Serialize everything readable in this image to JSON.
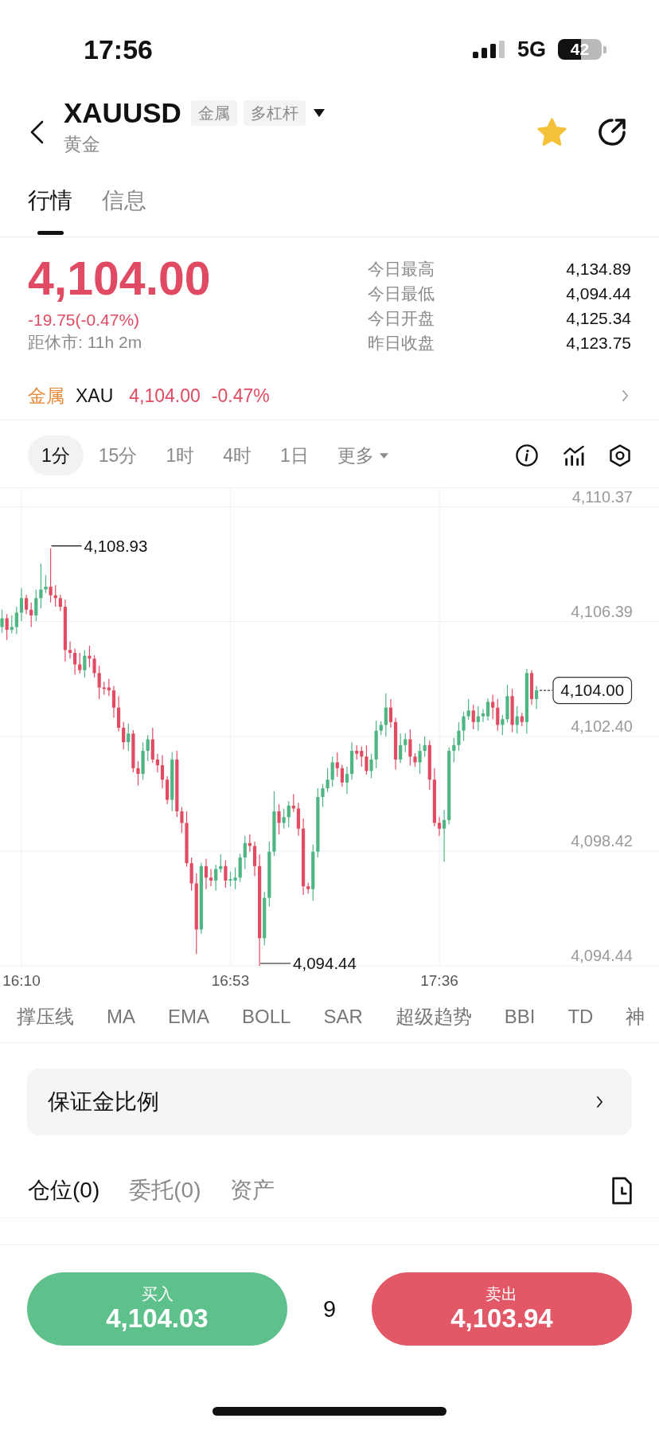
{
  "status_bar": {
    "time": "17:56",
    "network": "5G",
    "battery": "42"
  },
  "header": {
    "symbol": "XAUUSD",
    "tags": [
      "金属",
      "多杠杆"
    ],
    "subtitle": "黄金",
    "favorite": true
  },
  "tabs": [
    {
      "label": "行情",
      "selected": true
    },
    {
      "label": "信息",
      "selected": false
    }
  ],
  "quote": {
    "price": "4,104.00",
    "change": "-19.75(-0.47%)",
    "negative": true,
    "countdown": "距休市: 11h 2m",
    "stats": [
      {
        "label": "今日最高",
        "value": "4,134.89"
      },
      {
        "label": "今日最低",
        "value": "4,094.44"
      },
      {
        "label": "今日开盘",
        "value": "4,125.34"
      },
      {
        "label": "昨日收盘",
        "value": "4,123.75"
      }
    ]
  },
  "related": {
    "category": "金属",
    "symbol": "XAU",
    "price": "4,104.00",
    "change": "-0.47%",
    "negative": true
  },
  "intervals": [
    {
      "label": "1分",
      "kind": "option",
      "selected": true
    },
    {
      "label": "15分",
      "kind": "option",
      "selected": false
    },
    {
      "label": "1时",
      "kind": "option",
      "selected": false
    },
    {
      "label": "4时",
      "kind": "option",
      "selected": false
    },
    {
      "label": "1日",
      "kind": "option",
      "selected": false
    },
    {
      "label": "更多",
      "kind": "menu",
      "selected": false
    }
  ],
  "chart": {
    "chart_data": {
      "type": "candlestick",
      "categories": [
        null,
        null,
        null,
        null,
        "16:10",
        null,
        null,
        null,
        null,
        null,
        null,
        null,
        null,
        null,
        null,
        null,
        null,
        null,
        null,
        null,
        null,
        null,
        null,
        null,
        null,
        null,
        null,
        null,
        null,
        null,
        null,
        null,
        null,
        null,
        null,
        null,
        null,
        null,
        null,
        null,
        null,
        null,
        null,
        null,
        null,
        null,
        null,
        "16:53",
        null,
        null,
        null,
        null,
        null,
        null,
        null,
        null,
        null,
        null,
        null,
        null,
        null,
        null,
        null,
        null,
        null,
        null,
        null,
        null,
        null,
        null,
        null,
        null,
        null,
        null,
        null,
        null,
        null,
        null,
        null,
        null,
        null,
        null,
        null,
        null,
        null,
        null,
        null,
        null,
        null,
        null,
        "17:36",
        null,
        null,
        null,
        null,
        null,
        null,
        null,
        null,
        null,
        null,
        null,
        null,
        null,
        null,
        null,
        null,
        null,
        null,
        null,
        null
      ],
      "ohlc": [
        [
          4106.2,
          4106.8,
          4106.0,
          4106.5
        ],
        [
          4106.5,
          4106.65,
          4105.75,
          4106.1
        ],
        [
          4106.1,
          4106.6,
          4105.98,
          4106.2
        ],
        [
          4106.2,
          4106.9,
          4105.95,
          4106.7
        ],
        [
          4106.7,
          4107.55,
          4106.4,
          4107.2
        ],
        [
          4107.2,
          4107.32,
          4106.65,
          4106.8
        ],
        [
          4106.8,
          4107.05,
          4106.2,
          4106.6
        ],
        [
          4106.6,
          4107.5,
          4106.4,
          4107.2
        ],
        [
          4107.2,
          4108.4,
          4106.85,
          4107.5
        ],
        [
          4107.5,
          4108.0,
          4107.38,
          4107.6
        ],
        [
          4107.6,
          4108.93,
          4107.05,
          4107.3
        ],
        [
          4107.3,
          4107.65,
          4106.9,
          4107.2
        ],
        [
          4107.2,
          4107.32,
          4106.75,
          4106.9
        ],
        [
          4106.9,
          4107.15,
          4105.0,
          4105.4
        ],
        [
          4105.4,
          4105.7,
          4105.1,
          4105.3
        ],
        [
          4105.3,
          4105.45,
          4104.55,
          4104.9
        ],
        [
          4104.9,
          4105.3,
          4104.58,
          4104.7
        ],
        [
          4104.7,
          4105.4,
          4104.45,
          4105.2
        ],
        [
          4105.2,
          4105.55,
          4104.8,
          4105.1
        ],
        [
          4105.1,
          4105.22,
          4104.45,
          4104.6
        ],
        [
          4104.6,
          4104.85,
          4103.7,
          4104.1
        ],
        [
          4104.1,
          4104.3,
          4103.85,
          4104.05
        ],
        [
          4104.1,
          4104.4,
          4103.8,
          4104.0
        ],
        [
          4104.0,
          4104.15,
          4103.05,
          4103.4
        ],
        [
          4103.4,
          4103.8,
          4102.58,
          4102.7
        ],
        [
          4102.7,
          4102.9,
          4101.95,
          4102.2
        ],
        [
          4102.2,
          4102.85,
          4101.9,
          4102.5
        ],
        [
          4102.5,
          4102.62,
          4101.15,
          4101.3
        ],
        [
          4101.3,
          4101.55,
          4100.7,
          4101.1
        ],
        [
          4101.1,
          4102.2,
          4100.9,
          4101.9
        ],
        [
          4101.9,
          4102.45,
          4101.55,
          4102.3
        ],
        [
          4102.3,
          4102.7,
          4101.48,
          4101.6
        ],
        [
          4101.6,
          4101.8,
          4101.15,
          4101.4
        ],
        [
          4101.4,
          4101.75,
          4100.6,
          4100.9
        ],
        [
          4100.9,
          4101.02,
          4100.05,
          4100.2
        ],
        [
          4100.2,
          4101.85,
          4099.8,
          4101.6
        ],
        [
          4101.6,
          4101.9,
          4099.6,
          4099.8
        ],
        [
          4099.8,
          4099.95,
          4099.05,
          4099.4
        ],
        [
          4099.4,
          4099.8,
          4097.88,
          4098.0
        ],
        [
          4098.0,
          4098.2,
          4097.05,
          4097.3
        ],
        [
          4097.3,
          4097.65,
          4094.85,
          4095.7
        ],
        [
          4095.7,
          4098.02,
          4095.55,
          4097.9
        ],
        [
          4097.9,
          4098.15,
          4097.1,
          4097.5
        ],
        [
          4097.5,
          4097.8,
          4097.2,
          4097.4
        ],
        [
          4097.4,
          4097.95,
          4097.05,
          4097.8
        ],
        [
          4097.8,
          4098.3,
          4097.68,
          4097.9
        ],
        [
          4097.9,
          4098.1,
          4097.15,
          4097.4
        ],
        [
          4097.4,
          4097.7,
          4097.2,
          4097.45
        ],
        [
          4097.4,
          4097.85,
          4097.1,
          4097.5
        ],
        [
          4097.5,
          4098.32,
          4097.35,
          4098.2
        ],
        [
          4098.2,
          4098.95,
          4097.8,
          4098.7
        ],
        [
          4098.7,
          4099.0,
          4098.4,
          4098.6
        ],
        [
          4098.6,
          4098.75,
          4097.55,
          4097.9
        ],
        [
          4097.9,
          4098.3,
          4094.44,
          4095.4
        ],
        [
          4095.4,
          4097.0,
          4095.15,
          4096.8
        ],
        [
          4096.8,
          4098.75,
          4096.5,
          4098.4
        ],
        [
          4098.4,
          4100.5,
          4098.25,
          4099.8
        ],
        [
          4099.8,
          4100.05,
          4099.0,
          4099.4
        ],
        [
          4099.4,
          4099.9,
          4099.2,
          4099.6
        ],
        [
          4099.6,
          4100.15,
          4099.25,
          4100.0
        ],
        [
          4100.0,
          4100.4,
          4099.78,
          4099.9
        ],
        [
          4099.9,
          4100.1,
          4098.95,
          4099.2
        ],
        [
          4099.2,
          4099.55,
          4096.9,
          4097.2
        ],
        [
          4097.2,
          4097.32,
          4096.95,
          4097.1
        ],
        [
          4097.1,
          4098.65,
          4096.7,
          4098.4
        ],
        [
          4098.4,
          4100.6,
          4098.2,
          4100.3
        ],
        [
          4100.3,
          4100.75,
          4099.95,
          4100.6
        ],
        [
          4100.6,
          4101.3,
          4100.48,
          4100.9
        ],
        [
          4100.9,
          4101.7,
          4100.65,
          4101.5
        ],
        [
          4101.5,
          4101.85,
          4101.0,
          4101.3
        ],
        [
          4101.3,
          4101.42,
          4100.65,
          4100.8
        ],
        [
          4100.8,
          4101.35,
          4100.4,
          4101.1
        ],
        [
          4101.1,
          4102.2,
          4100.9,
          4101.9
        ],
        [
          4101.9,
          4102.1,
          4101.6,
          4101.8
        ],
        [
          4101.9,
          4102.05,
          4101.35,
          4101.7
        ],
        [
          4101.7,
          4102.1,
          4101.08,
          4101.2
        ],
        [
          4101.2,
          4101.8,
          4100.95,
          4101.6
        ],
        [
          4101.6,
          4102.95,
          4101.3,
          4102.6
        ],
        [
          4102.6,
          4102.92,
          4102.45,
          4102.8
        ],
        [
          4102.8,
          4103.9,
          4102.4,
          4103.4
        ],
        [
          4103.4,
          4103.7,
          4102.7,
          4102.9
        ],
        [
          4102.9,
          4103.05,
          4101.25,
          4101.6
        ],
        [
          4101.6,
          4102.5,
          4101.48,
          4102.1
        ],
        [
          4102.1,
          4102.5,
          4101.85,
          4102.3
        ],
        [
          4102.3,
          4102.65,
          4101.4,
          4101.7
        ],
        [
          4101.7,
          4101.82,
          4101.35,
          4101.5
        ],
        [
          4101.5,
          4102.15,
          4101.1,
          4101.9
        ],
        [
          4101.9,
          4102.4,
          4101.7,
          4102.1
        ],
        [
          4102.1,
          4102.25,
          4100.55,
          4100.9
        ],
        [
          4100.9,
          4101.3,
          4099.28,
          4099.4
        ],
        [
          4099.4,
          4099.6,
          4098.95,
          4099.2
        ],
        [
          4099.2,
          4099.85,
          4098.05,
          4099.5
        ],
        [
          4099.5,
          4102.02,
          4099.35,
          4101.9
        ],
        [
          4101.9,
          4102.35,
          4101.5,
          4102.1
        ],
        [
          4102.1,
          4102.9,
          4101.9,
          4102.6
        ],
        [
          4102.6,
          4103.25,
          4102.25,
          4103.1
        ],
        [
          4103.1,
          4103.7,
          4102.98,
          4103.3
        ],
        [
          4103.3,
          4103.5,
          4102.65,
          4102.9
        ],
        [
          4102.9,
          4103.45,
          4102.6,
          4103.1
        ],
        [
          4103.1,
          4103.35,
          4102.9,
          4103.2
        ],
        [
          4103.1,
          4103.72,
          4102.95,
          4103.6
        ],
        [
          4103.6,
          4103.85,
          4103.0,
          4103.4
        ],
        [
          4103.4,
          4103.7,
          4102.6,
          4102.8
        ],
        [
          4102.8,
          4103.15,
          4102.45,
          4103.0
        ],
        [
          4103.0,
          4104.2,
          4102.88,
          4103.8
        ],
        [
          4103.8,
          4104.05,
          4102.55,
          4102.8
        ],
        [
          4102.8,
          4103.45,
          4102.5,
          4103.1
        ],
        [
          4103.1,
          4103.22,
          4102.75,
          4102.9
        ],
        [
          4102.9,
          4104.75,
          4102.5,
          4104.6
        ],
        [
          4104.6,
          4104.7,
          4103.5,
          4103.7
        ],
        [
          4103.7,
          4104.15,
          4103.35,
          4104.0
        ]
      ],
      "ylim": [
        4094.44,
        4111.02
      ],
      "yticks": [
        {
          "value": 4110.37,
          "label": "4,110.37"
        },
        {
          "value": 4106.39,
          "label": "4,106.39"
        },
        {
          "value": 4102.4,
          "label": "4,102.40"
        },
        {
          "value": 4098.42,
          "label": "4,098.42"
        },
        {
          "value": 4094.44,
          "label": "4,094.44"
        }
      ],
      "grid": true,
      "annotations": [
        "4,108.93",
        "4,094.44"
      ],
      "ref_lines": [
        {
          "axis": "y",
          "value": 4104,
          "label": "4,104.00"
        }
      ]
    }
  },
  "indicators": [
    "撑压线",
    "MA",
    "EMA",
    "BOLL",
    "SAR",
    "超级趋势",
    "BBI",
    "TD",
    "神"
  ],
  "margin": {
    "label": "保证金比例"
  },
  "account_tabs": [
    {
      "label": "仓位(0)",
      "selected": true
    },
    {
      "label": "委托(0)",
      "selected": false
    },
    {
      "label": "资产",
      "selected": false
    }
  ],
  "trade": {
    "buy": {
      "label": "买入",
      "price": "4,104.03"
    },
    "spread": "9",
    "sell": {
      "label": "卖出",
      "price": "4,103.94"
    }
  }
}
